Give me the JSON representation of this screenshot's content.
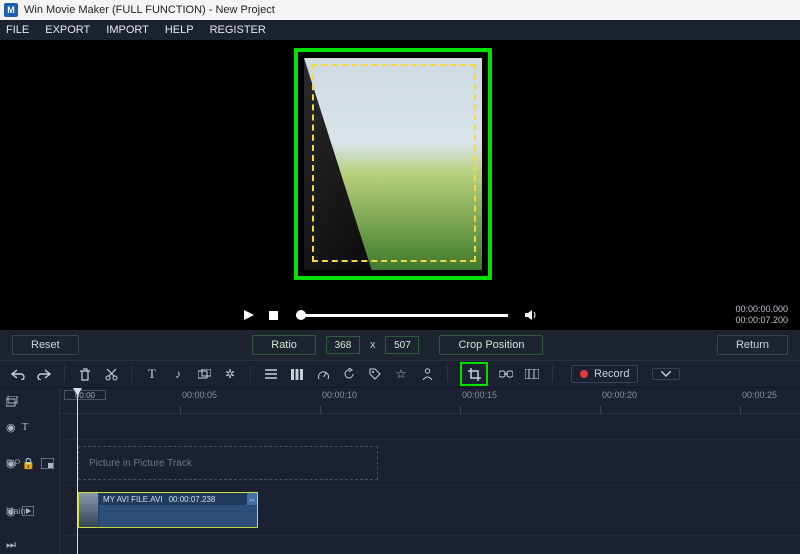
{
  "window": {
    "title": "Win Movie Maker (FULL FUNCTION) - New Project"
  },
  "menu": {
    "items": [
      "FILE",
      "EXPORT",
      "IMPORT",
      "HELP",
      "REGISTER"
    ]
  },
  "playback": {
    "time_current": "00:00:00.000",
    "time_total": "00:00:07.200"
  },
  "crop": {
    "reset": "Reset",
    "ratio_label": "Ratio",
    "width": "368",
    "height": "507",
    "x_label": "x",
    "position_label": "Crop Position",
    "return": "Return"
  },
  "toolbar": {
    "record_label": "Record"
  },
  "timeline": {
    "zoom": "00:00",
    "ticks": [
      "00:00:05",
      "00:00:10",
      "00:00:15",
      "00:00:20",
      "00:00:25"
    ],
    "tracks": {
      "text_label": "",
      "pip_label": "PIP",
      "pip_placeholder": "Picture in Picture Track",
      "main_label": "Main"
    },
    "clip": {
      "name": "MY AVI FILE.AVI",
      "duration": "00:00:07.238"
    }
  }
}
